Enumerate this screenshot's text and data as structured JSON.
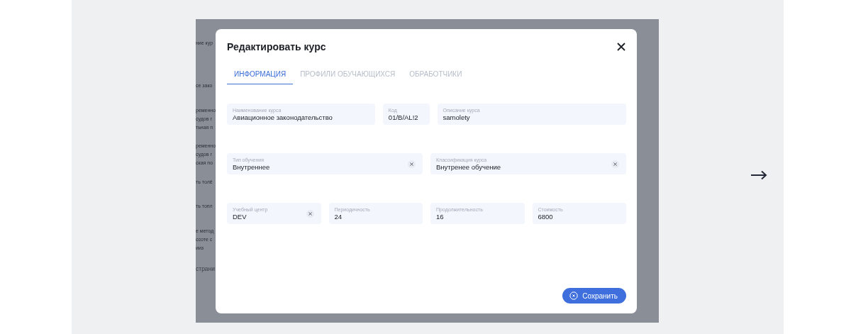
{
  "background_items": [
    {
      "lines": [
        "ние кур"
      ]
    },
    {
      "lines": [
        "се зако"
      ]
    },
    {
      "lines": [
        "ременно",
        "судов г",
        "тьная п"
      ]
    },
    {
      "lines": [
        "ременно",
        "судов г",
        "ская по"
      ]
    },
    {
      "lines": [
        "ть толё"
      ]
    },
    {
      "lines": [
        "ть топл"
      ]
    },
    {
      "lines": [
        "е метод",
        "ссоте с",
        "ииз"
      ]
    },
    {
      "lines": [
        "страни"
      ],
      "kind": "link"
    }
  ],
  "dialog": {
    "title": "Редактировать курс",
    "tabs": [
      {
        "label": "ИНФОРМАЦИЯ",
        "selected": true
      },
      {
        "label": "ПРОФИЛИ ОБУЧАЮЩИХСЯ",
        "selected": false
      },
      {
        "label": "ОБРАБОТЧИКИ",
        "selected": false
      }
    ],
    "field_rows": [
      [
        {
          "label": "Наименование курса",
          "value": "Авиационное законодательство",
          "clearable": false
        },
        {
          "label": "Код",
          "value": "01/B/AL!2",
          "clearable": false
        },
        {
          "label": "Описание курса",
          "value": "samolety",
          "clearable": false
        }
      ],
      [
        {
          "label": "Тип обучения",
          "value": "Внутреннее",
          "clearable": true
        },
        {
          "label": "Классификация курса",
          "value": "Внутренее обучение",
          "clearable": true
        }
      ],
      [
        {
          "label": "Учебный центр",
          "value": "DEV",
          "clearable": true
        },
        {
          "label": "Периодичность",
          "value": "24",
          "clearable": false
        },
        {
          "label": "Продолжительность",
          "value": "16",
          "clearable": false
        },
        {
          "label": "Стоимость",
          "value": "6800",
          "clearable": false
        }
      ]
    ],
    "save_button": {
      "label": "Сохранить"
    }
  }
}
